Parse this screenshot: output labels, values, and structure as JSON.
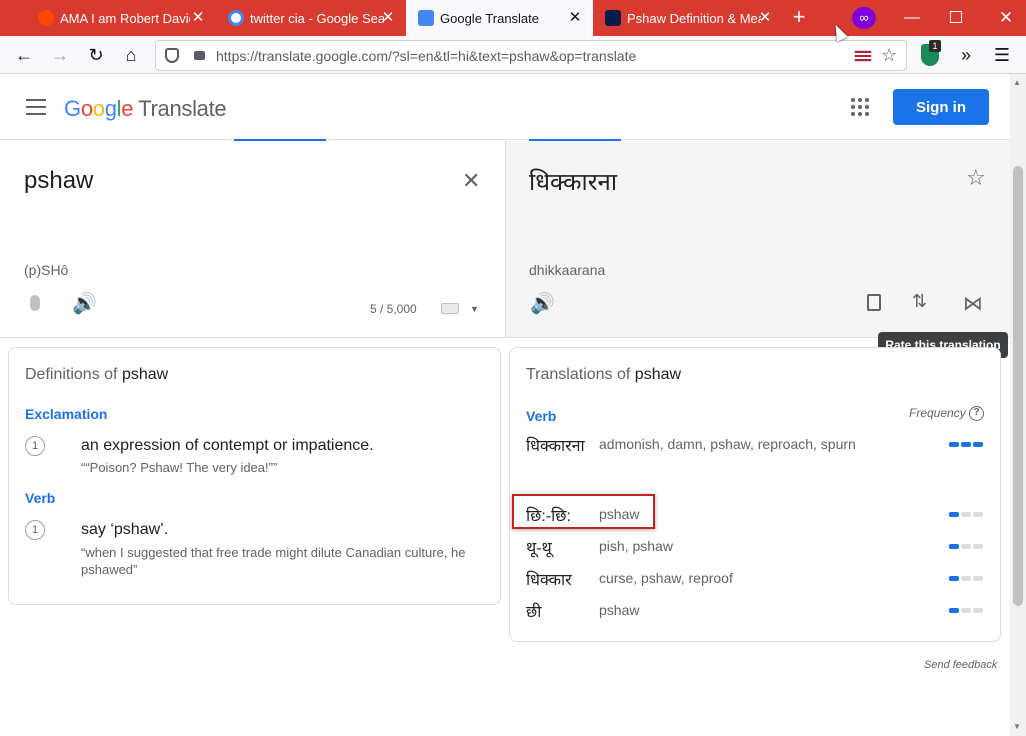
{
  "browser": {
    "tabs": [
      {
        "label": "AMA I am Robert David St",
        "active": false
      },
      {
        "label": "twitter cia - Google Search",
        "active": false
      },
      {
        "label": "Google Translate",
        "active": true
      },
      {
        "label": "Pshaw Definition & Mean",
        "active": false
      }
    ],
    "url": "https://translate.google.com/?sl=en&tl=hi&text=pshaw&op=translate",
    "extension_badge": "1"
  },
  "header": {
    "logo_letters": [
      "G",
      "o",
      "o",
      "g",
      "l",
      "e"
    ],
    "logo_product": "Translate",
    "signin_label": "Sign in"
  },
  "source": {
    "text": "pshaw",
    "pronunciation": "(p)SHô",
    "char_count": "5 / 5,000"
  },
  "target": {
    "text": "धिक्कारना",
    "romanization": "dhikkaarana",
    "tooltip": "Rate this translation"
  },
  "definitions": {
    "title_prefix": "Definitions of",
    "word": "pshaw",
    "groups": [
      {
        "pos": "Exclamation",
        "num": "1",
        "meaning": "an expression of contempt or impatience.",
        "example": "““Poison? Pshaw! The very idea!””"
      },
      {
        "pos": "Verb",
        "num": "1",
        "meaning": "say ‘pshaw’.",
        "example": "“when I suggested that free trade might dilute Canadian culture, he pshawed”"
      }
    ]
  },
  "translations": {
    "title_prefix": "Translations of",
    "word": "pshaw",
    "pos": "Verb",
    "frequency_label": "Frequency",
    "rows": [
      {
        "word": "धिक्कारना",
        "synonyms": "admonish, damn, pshaw, reproach, spurn",
        "frequency": 3
      },
      {
        "word": "छि:-छि:",
        "synonyms": "pshaw",
        "frequency": 1
      },
      {
        "word": "थू-थू",
        "synonyms": "pish, pshaw",
        "frequency": 1
      },
      {
        "word": "धिक्कार",
        "synonyms": "curse, pshaw, reproof",
        "frequency": 1
      },
      {
        "word": "छी",
        "synonyms": "pshaw",
        "frequency": 1
      }
    ]
  },
  "footer": {
    "feedback": "Send feedback"
  },
  "colors": {
    "tabstrip": "#d93a2f",
    "accent": "#1a73e8",
    "highlight_box": "#c5221f"
  }
}
